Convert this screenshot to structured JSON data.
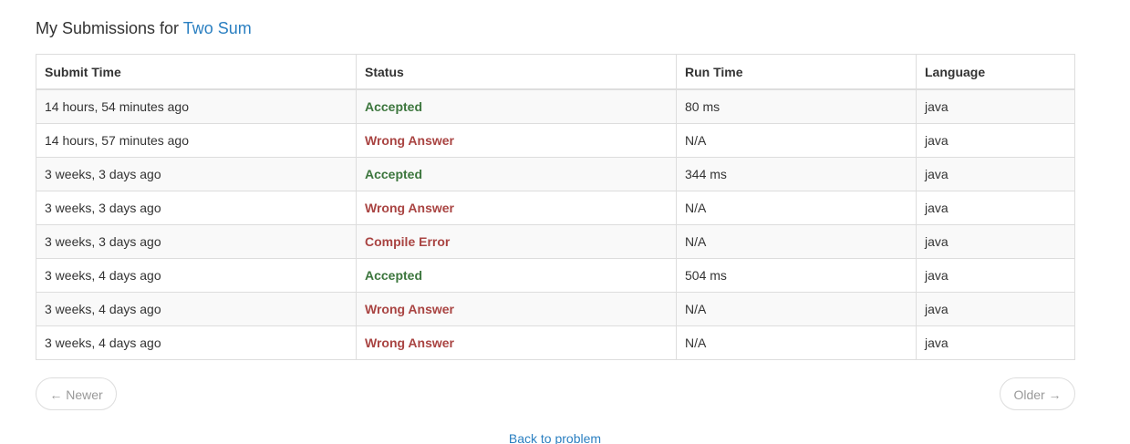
{
  "header": {
    "prefix": "My Submissions for",
    "problem_link": "Two Sum"
  },
  "table": {
    "columns": [
      "Submit Time",
      "Status",
      "Run Time",
      "Language"
    ],
    "rows": [
      {
        "submit_time": "14 hours, 54 minutes ago",
        "status": "Accepted",
        "run_time": "80 ms",
        "language": "java"
      },
      {
        "submit_time": "14 hours, 57 minutes ago",
        "status": "Wrong Answer",
        "run_time": "N/A",
        "language": "java"
      },
      {
        "submit_time": "3 weeks, 3 days ago",
        "status": "Accepted",
        "run_time": "344 ms",
        "language": "java"
      },
      {
        "submit_time": "3 weeks, 3 days ago",
        "status": "Wrong Answer",
        "run_time": "N/A",
        "language": "java"
      },
      {
        "submit_time": "3 weeks, 3 days ago",
        "status": "Compile Error",
        "run_time": "N/A",
        "language": "java"
      },
      {
        "submit_time": "3 weeks, 4 days ago",
        "status": "Accepted",
        "run_time": "504 ms",
        "language": "java"
      },
      {
        "submit_time": "3 weeks, 4 days ago",
        "status": "Wrong Answer",
        "run_time": "N/A",
        "language": "java"
      },
      {
        "submit_time": "3 weeks, 4 days ago",
        "status": "Wrong Answer",
        "run_time": "N/A",
        "language": "java"
      }
    ]
  },
  "pager": {
    "newer_label": "← Newer",
    "older_label": "Older →"
  },
  "footer": {
    "back_link": "Back to problem"
  },
  "colors": {
    "link": "#2a7fc1",
    "accepted": "#3c763d",
    "failed": "#a94442"
  }
}
